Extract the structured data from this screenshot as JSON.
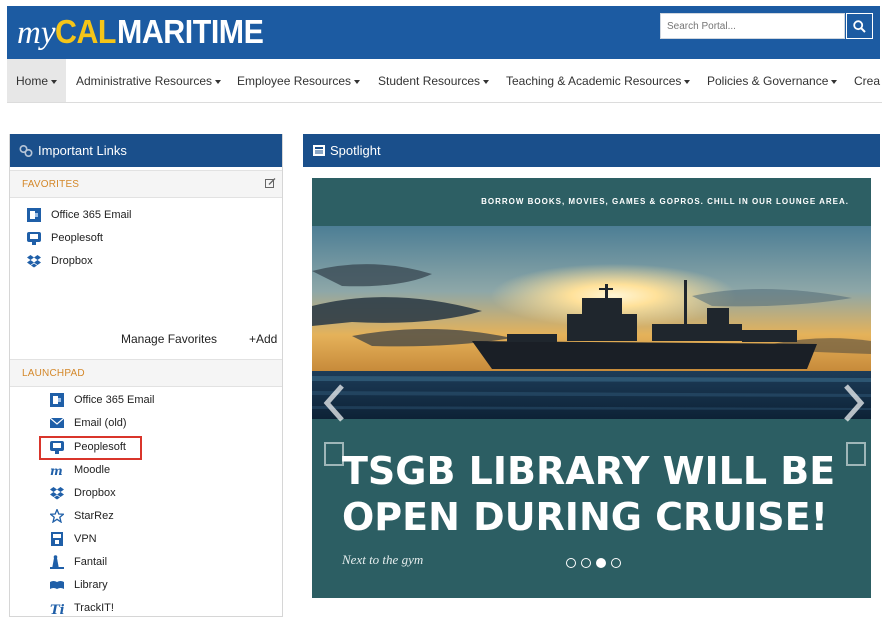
{
  "header": {
    "logo_my": "my",
    "logo_cal": "CAL",
    "logo_maritime": "MARITIME",
    "search_placeholder": "Search Portal..."
  },
  "nav": {
    "items": [
      {
        "label": "Home"
      },
      {
        "label": "Administrative Resources"
      },
      {
        "label": "Employee Resources"
      },
      {
        "label": "Student Resources"
      },
      {
        "label": "Teaching & Academic Resources"
      },
      {
        "label": "Policies & Governance"
      },
      {
        "label": "Crea"
      }
    ]
  },
  "important_links": {
    "title": "Important Links",
    "favorites": {
      "heading": "FAVORITES",
      "items": [
        {
          "label": "Office 365 Email",
          "icon": "office365-icon"
        },
        {
          "label": "Peoplesoft",
          "icon": "peoplesoft-icon"
        },
        {
          "label": "Dropbox",
          "icon": "dropbox-icon"
        }
      ],
      "manage_label": "Manage Favorites",
      "add_label": "+Add"
    },
    "launchpad": {
      "heading": "LAUNCHPAD",
      "items": [
        {
          "label": "Office 365 Email",
          "icon": "office365-icon"
        },
        {
          "label": "Email (old)",
          "icon": "envelope-icon"
        },
        {
          "label": "Peoplesoft",
          "icon": "peoplesoft-icon"
        },
        {
          "label": "Moodle",
          "icon": "moodle-icon"
        },
        {
          "label": "Dropbox",
          "icon": "dropbox-icon"
        },
        {
          "label": "StarRez",
          "icon": "star-icon"
        },
        {
          "label": "VPN",
          "icon": "vpn-icon"
        },
        {
          "label": "Fantail",
          "icon": "fantail-icon"
        },
        {
          "label": "Library",
          "icon": "book-icon"
        },
        {
          "label": "TrackIT!",
          "icon": "trackit-icon"
        }
      ]
    }
  },
  "spotlight": {
    "title": "Spotlight",
    "tagline": "BORROW BOOKS, MOVIES, GAMES & GOPROS. CHILL IN OUR LOUNGE AREA.",
    "headline_line1": "TSGB LIBRARY WILL BE",
    "headline_line2": "OPEN DURING CRUISE!",
    "caption": "Next to the gym",
    "active_slide": 3,
    "total_slides": 4
  },
  "colors": {
    "header_blue": "#1c5ba2",
    "panel_blue": "#1a4f8b",
    "logo_yellow": "#f5c518",
    "section_orange": "#d4882a",
    "highlight_red": "#d9352b",
    "slide_teal": "#2c5e63"
  }
}
